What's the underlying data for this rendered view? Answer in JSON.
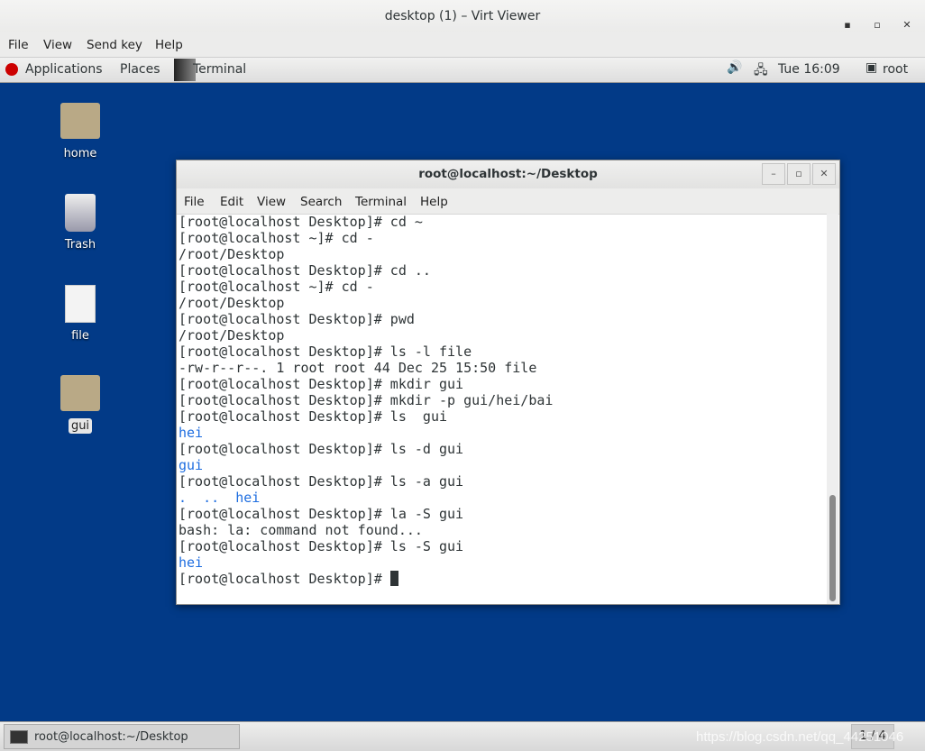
{
  "window": {
    "title": "desktop (1) – Virt Viewer",
    "minimize": "▪",
    "maximize": "▫",
    "close": "✕"
  },
  "menu": [
    "File",
    "View",
    "Send key",
    "Help"
  ],
  "panel": {
    "applications": "Applications",
    "places": "Places",
    "task": "Terminal",
    "clock": "Tue 16:09",
    "user": "root"
  },
  "desktop_icons": [
    {
      "label": "home"
    },
    {
      "label": "Trash"
    },
    {
      "label": "file"
    },
    {
      "label": "gui"
    }
  ],
  "terminal": {
    "title": "root@localhost:~/Desktop",
    "menu": [
      "File",
      "Edit",
      "View",
      "Search",
      "Terminal",
      "Help"
    ],
    "lines": [
      {
        "text": "[root@localhost Desktop]# cd ~"
      },
      {
        "text": "[root@localhost ~]# cd -"
      },
      {
        "text": "/root/Desktop"
      },
      {
        "text": "[root@localhost Desktop]# cd .."
      },
      {
        "text": "[root@localhost ~]# cd -"
      },
      {
        "text": "/root/Desktop"
      },
      {
        "text": "[root@localhost Desktop]# pwd"
      },
      {
        "text": "/root/Desktop"
      },
      {
        "text": "[root@localhost Desktop]# ls -l file"
      },
      {
        "text": "-rw-r--r--. 1 root root 44 Dec 25 15:50 file"
      },
      {
        "text": "[root@localhost Desktop]# mkdir gui"
      },
      {
        "text": "[root@localhost Desktop]# mkdir -p gui/hei/bai"
      },
      {
        "text": "[root@localhost Desktop]# ls  gui"
      },
      {
        "text": "hei",
        "color": "blue"
      },
      {
        "text": "[root@localhost Desktop]# ls -d gui"
      },
      {
        "text": "gui",
        "color": "blue"
      },
      {
        "text": "[root@localhost Desktop]# ls -a gui"
      },
      {
        "text": ".  ..  hei",
        "color": "blue"
      },
      {
        "text": "[root@localhost Desktop]# la -S gui"
      },
      {
        "text": "bash: la: command not found..."
      },
      {
        "text": "[root@localhost Desktop]# ls -S gui"
      },
      {
        "text": "hei",
        "color": "blue"
      },
      {
        "text": "[root@localhost Desktop]# ",
        "cursor": true
      }
    ]
  },
  "taskbar": {
    "item": "root@localhost:~/Desktop",
    "workspace": "1 / 4",
    "watermark": "https://blog.csdn.net/qq_44251046"
  },
  "colors": {
    "desktop": "#023a87",
    "link_blue": "#1f6ee0"
  }
}
